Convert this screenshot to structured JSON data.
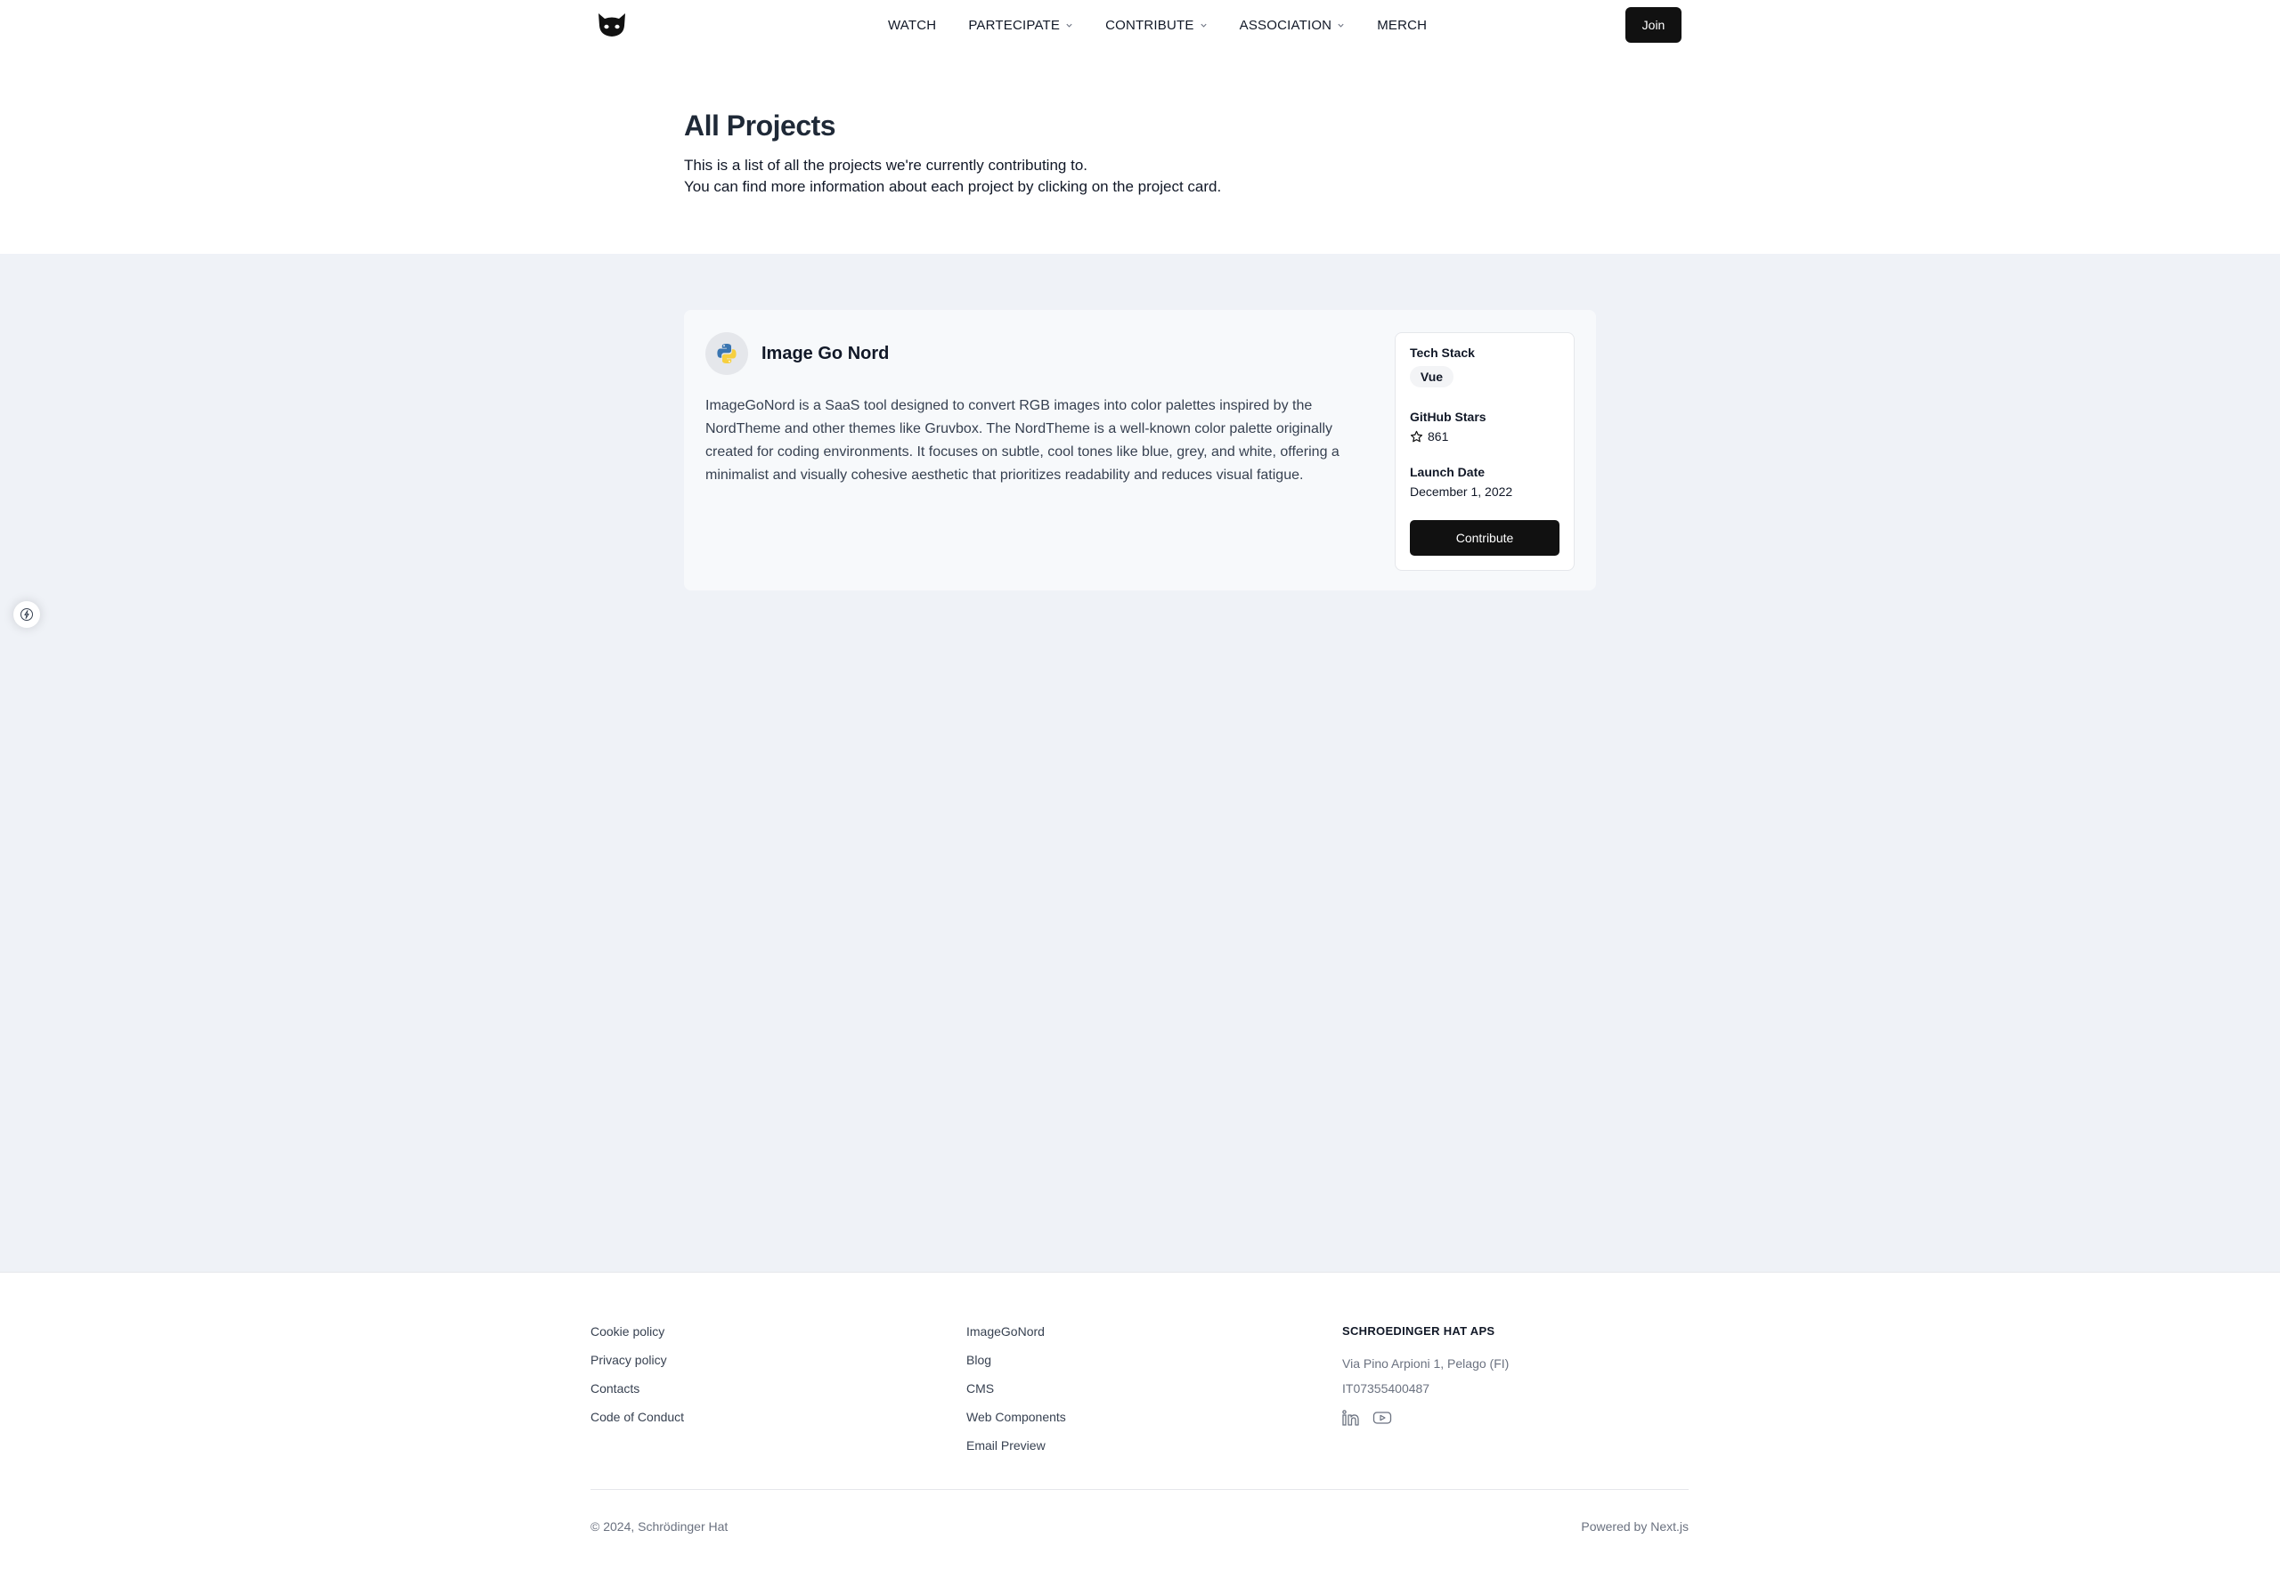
{
  "nav": {
    "items": [
      {
        "label": "WATCH",
        "has_dropdown": false
      },
      {
        "label": "PARTECIPATE",
        "has_dropdown": true
      },
      {
        "label": "CONTRIBUTE",
        "has_dropdown": true
      },
      {
        "label": "ASSOCIATION",
        "has_dropdown": true
      },
      {
        "label": "MERCH",
        "has_dropdown": false
      }
    ],
    "join_label": "Join",
    "logo_icon": "cat-logo-icon"
  },
  "hero": {
    "title": "All Projects",
    "line1": "This is a list of all the projects we're currently contributing to.",
    "line2": "You can find more information about each project by clicking on the project card."
  },
  "project": {
    "icon": "python-icon",
    "name": "Image Go Nord",
    "description": "ImageGoNord is a SaaS tool designed to convert RGB images into color palettes inspired by the NordTheme and other themes like Gruvbox. The NordTheme is a well-known color palette originally created for coding environments. It focuses on subtle, cool tones like blue, grey, and white, offering a minimalist and visually cohesive aesthetic that prioritizes readability and reduces visual fatigue.",
    "tech_stack_label": "Tech Stack",
    "tech_stack": [
      "Vue"
    ],
    "stars_label": "GitHub Stars",
    "stars": "861",
    "launch_label": "Launch Date",
    "launch_date": "December 1, 2022",
    "contribute_label": "Contribute"
  },
  "footer": {
    "col1": [
      "Cookie policy",
      "Privacy policy",
      "Contacts",
      "Code of Conduct"
    ],
    "col2": [
      "ImageGoNord",
      "Blog",
      "CMS",
      "Web Components",
      "Email Preview"
    ],
    "company": "SCHROEDINGER HAT APS",
    "address": "Via Pino Arpioni 1, Pelago (FI)",
    "vat": "IT07355400487",
    "socials": [
      "linkedin-icon",
      "youtube-icon"
    ],
    "copyright": "© 2024, Schrödinger Hat",
    "powered": "Powered by Next.js"
  },
  "colors": {
    "accent": "#111111",
    "page_bg": "#eff2f7",
    "card_bg": "#f7f9fb"
  }
}
